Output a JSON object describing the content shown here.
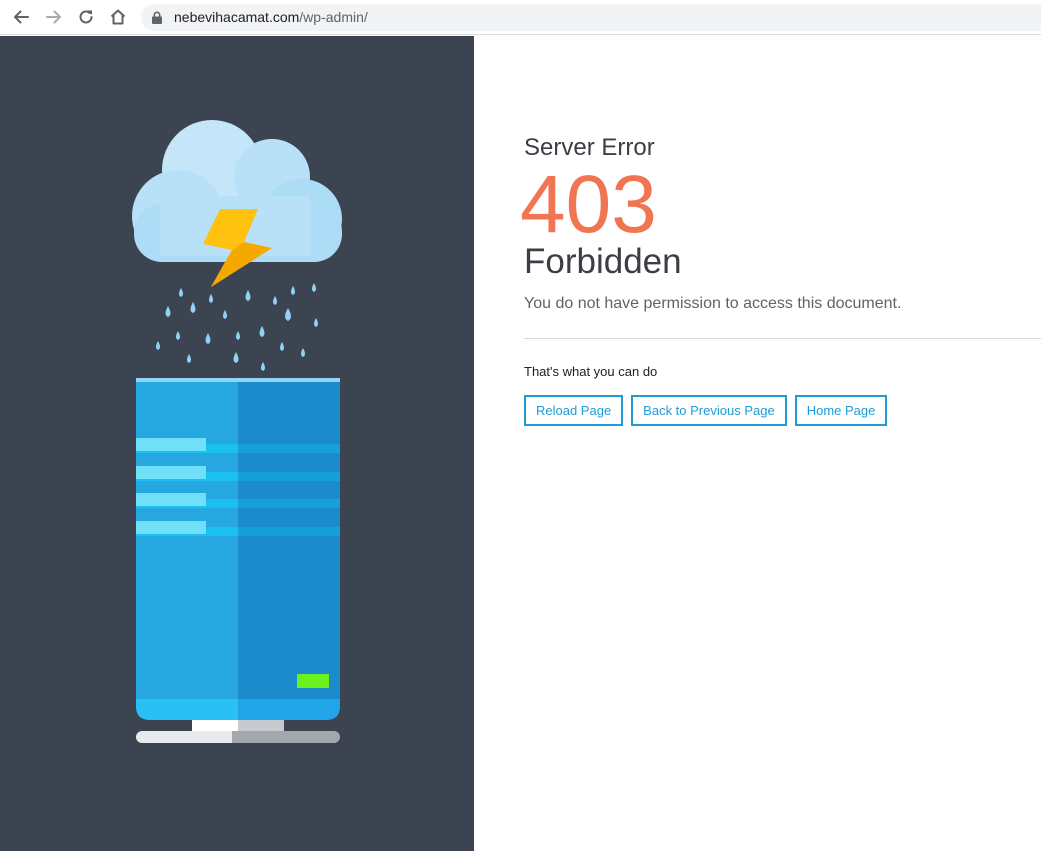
{
  "browser": {
    "url_host": "nebevihacamat.com",
    "url_path": "/wp-admin/",
    "icons": {
      "back": "arrow-left-icon",
      "forward": "arrow-right-icon",
      "reload": "reload-icon",
      "home": "home-icon",
      "lock": "lock-icon"
    }
  },
  "error": {
    "heading": "Server Error",
    "code": "403",
    "status": "Forbidden",
    "description": "You do not have permission to access this document."
  },
  "help": {
    "title": "That's what you can do",
    "buttons": [
      {
        "label": "Reload Page"
      },
      {
        "label": "Back to Previous Page"
      },
      {
        "label": "Home Page"
      }
    ]
  },
  "colors": {
    "panel_bg": "#3b4450",
    "accent_code": "#f07552",
    "button_border": "#1f9bd6",
    "text_dark": "#3b3f45"
  },
  "illustration": {
    "subject": "storm-cloud-over-server",
    "status_light": "green"
  }
}
